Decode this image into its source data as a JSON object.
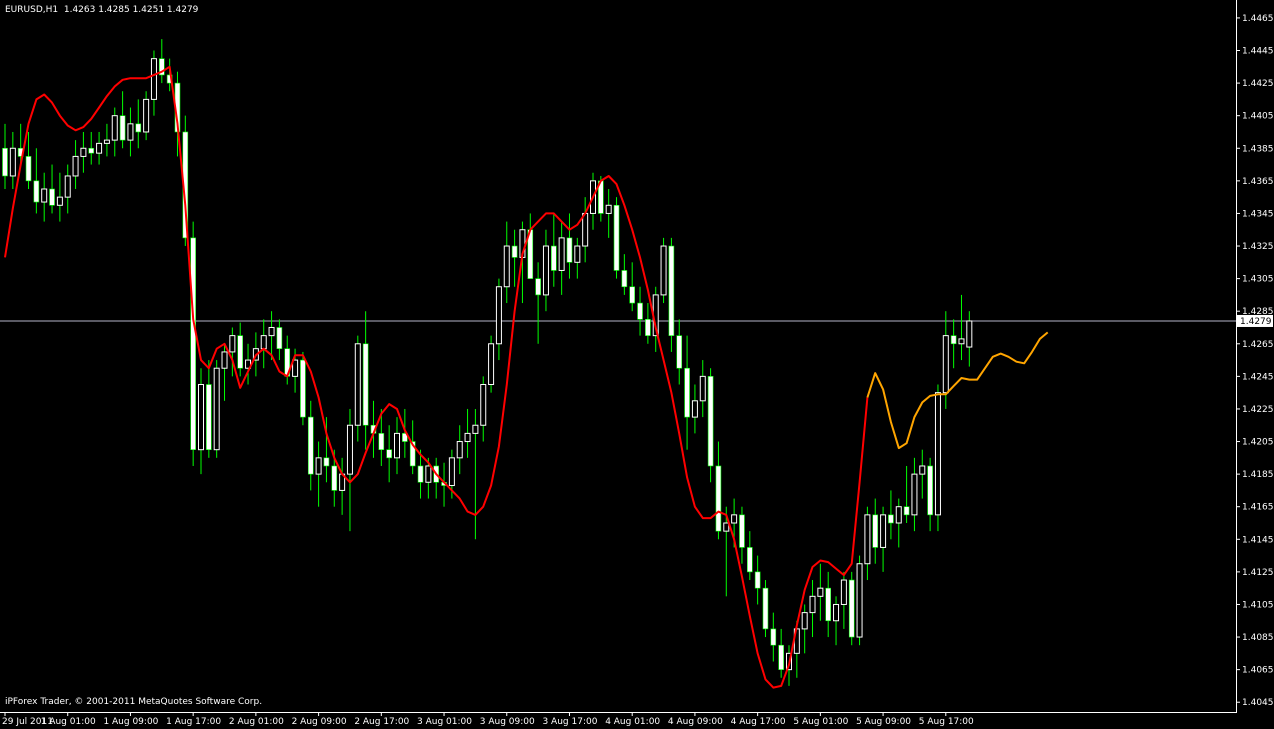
{
  "header": {
    "symbol_tf": "EURUSD,H1",
    "ohlc": "1.4263 1.4285 1.4251 1.4279"
  },
  "footer": {
    "copyright": "iPForex Trader, © 2001-2011 MetaQuotes Software Corp."
  },
  "colors": {
    "background": "#000000",
    "bull_candle": "#FFFFFF",
    "bear_candle": "#FFFFFF",
    "wick": "#00FF00",
    "ma_line": "#FF0000",
    "forecast_line": "#FFA500",
    "price_line": "#B4B4C8",
    "axis": "#FFFFFF"
  },
  "chart_data": {
    "type": "candlestick",
    "grid": false,
    "current_price": "1.4279",
    "y_ticks": [
      "1.4465",
      "1.4445",
      "1.4425",
      "1.4405",
      "1.4385",
      "1.4365",
      "1.4345",
      "1.4325",
      "1.4305",
      "1.4285",
      "1.4265",
      "1.4245",
      "1.4225",
      "1.4205",
      "1.4185",
      "1.4165",
      "1.4145",
      "1.4125",
      "1.4105",
      "1.4085",
      "1.4065",
      "1.4045"
    ],
    "y_tick_values": [
      1.4465,
      1.4445,
      1.4425,
      1.4405,
      1.4385,
      1.4365,
      1.4345,
      1.4325,
      1.4305,
      1.4285,
      1.4265,
      1.4245,
      1.4225,
      1.4205,
      1.4185,
      1.4165,
      1.4145,
      1.4125,
      1.4105,
      1.4085,
      1.4065,
      1.4045
    ],
    "ylim": [
      1.4039,
      1.4476
    ],
    "x_labels": [
      {
        "text": "29 Jul 2011",
        "index": 0
      },
      {
        "text": "1 Aug 01:00",
        "index": 8
      },
      {
        "text": "1 Aug 09:00",
        "index": 16
      },
      {
        "text": "1 Aug 17:00",
        "index": 24
      },
      {
        "text": "2 Aug 01:00",
        "index": 32
      },
      {
        "text": "2 Aug 09:00",
        "index": 40
      },
      {
        "text": "2 Aug 17:00",
        "index": 48
      },
      {
        "text": "3 Aug 01:00",
        "index": 56
      },
      {
        "text": "3 Aug 09:00",
        "index": 64
      },
      {
        "text": "3 Aug 17:00",
        "index": 72
      },
      {
        "text": "4 Aug 01:00",
        "index": 80
      },
      {
        "text": "4 Aug 09:00",
        "index": 88
      },
      {
        "text": "4 Aug 17:00",
        "index": 96
      },
      {
        "text": "5 Aug 01:00",
        "index": 104
      },
      {
        "text": "5 Aug 09:00",
        "index": 112
      },
      {
        "text": "5 Aug 17:00",
        "index": 120
      }
    ],
    "candles": [
      [
        1.4385,
        1.44,
        1.436,
        1.4368
      ],
      [
        1.4368,
        1.4395,
        1.436,
        1.4385
      ],
      [
        1.4385,
        1.44,
        1.4375,
        1.438
      ],
      [
        1.438,
        1.4395,
        1.436,
        1.4365
      ],
      [
        1.4365,
        1.4385,
        1.4345,
        1.4352
      ],
      [
        1.4352,
        1.437,
        1.434,
        1.436
      ],
      [
        1.436,
        1.4375,
        1.4345,
        1.435
      ],
      [
        1.435,
        1.437,
        1.434,
        1.4355
      ],
      [
        1.4355,
        1.4375,
        1.4345,
        1.4368
      ],
      [
        1.4368,
        1.439,
        1.436,
        1.438
      ],
      [
        1.438,
        1.4395,
        1.437,
        1.4385
      ],
      [
        1.4385,
        1.4395,
        1.4375,
        1.4382
      ],
      [
        1.4382,
        1.4395,
        1.4375,
        1.4388
      ],
      [
        1.4388,
        1.44,
        1.438,
        1.439
      ],
      [
        1.439,
        1.441,
        1.438,
        1.4405
      ],
      [
        1.4405,
        1.442,
        1.4385,
        1.439
      ],
      [
        1.439,
        1.441,
        1.438,
        1.44
      ],
      [
        1.44,
        1.4415,
        1.4385,
        1.4395
      ],
      [
        1.4395,
        1.442,
        1.439,
        1.4415
      ],
      [
        1.4415,
        1.4445,
        1.4405,
        1.444
      ],
      [
        1.444,
        1.4452,
        1.4425,
        1.443
      ],
      [
        1.443,
        1.444,
        1.442,
        1.4425
      ],
      [
        1.4425,
        1.4432,
        1.438,
        1.4395
      ],
      [
        1.4395,
        1.4405,
        1.4325,
        1.433
      ],
      [
        1.433,
        1.434,
        1.419,
        1.42
      ],
      [
        1.42,
        1.425,
        1.4185,
        1.424
      ],
      [
        1.424,
        1.4255,
        1.4195,
        1.42
      ],
      [
        1.42,
        1.4255,
        1.4195,
        1.425
      ],
      [
        1.425,
        1.4265,
        1.423,
        1.426
      ],
      [
        1.426,
        1.4275,
        1.4245,
        1.427
      ],
      [
        1.427,
        1.4278,
        1.4245,
        1.425
      ],
      [
        1.425,
        1.4265,
        1.424,
        1.4255
      ],
      [
        1.4255,
        1.4272,
        1.4245,
        1.4262
      ],
      [
        1.4262,
        1.428,
        1.425,
        1.427
      ],
      [
        1.427,
        1.4285,
        1.4255,
        1.4275
      ],
      [
        1.4275,
        1.428,
        1.4255,
        1.4262
      ],
      [
        1.4262,
        1.427,
        1.424,
        1.4245
      ],
      [
        1.4245,
        1.4262,
        1.4235,
        1.4255
      ],
      [
        1.4255,
        1.426,
        1.4215,
        1.422
      ],
      [
        1.422,
        1.423,
        1.4175,
        1.4185
      ],
      [
        1.4185,
        1.4205,
        1.4165,
        1.4195
      ],
      [
        1.4195,
        1.422,
        1.418,
        1.419
      ],
      [
        1.419,
        1.42,
        1.4165,
        1.4175
      ],
      [
        1.4175,
        1.4195,
        1.416,
        1.4185
      ],
      [
        1.4185,
        1.4225,
        1.415,
        1.4215
      ],
      [
        1.4215,
        1.427,
        1.4205,
        1.4265
      ],
      [
        1.4265,
        1.4285,
        1.42,
        1.4215
      ],
      [
        1.4215,
        1.423,
        1.4195,
        1.421
      ],
      [
        1.421,
        1.4225,
        1.419,
        1.42
      ],
      [
        1.42,
        1.4215,
        1.418,
        1.4195
      ],
      [
        1.4195,
        1.422,
        1.4185,
        1.421
      ],
      [
        1.421,
        1.4225,
        1.4195,
        1.4205
      ],
      [
        1.4205,
        1.4218,
        1.4185,
        1.419
      ],
      [
        1.419,
        1.42,
        1.417,
        1.418
      ],
      [
        1.418,
        1.4195,
        1.417,
        1.419
      ],
      [
        1.419,
        1.4195,
        1.417,
        1.418
      ],
      [
        1.418,
        1.4192,
        1.4165,
        1.4178
      ],
      [
        1.4178,
        1.42,
        1.417,
        1.4195
      ],
      [
        1.4195,
        1.4215,
        1.4185,
        1.4205
      ],
      [
        1.4205,
        1.4225,
        1.4195,
        1.421
      ],
      [
        1.421,
        1.4225,
        1.4145,
        1.4215
      ],
      [
        1.4215,
        1.4245,
        1.4205,
        1.424
      ],
      [
        1.424,
        1.427,
        1.4235,
        1.4265
      ],
      [
        1.4265,
        1.4305,
        1.4255,
        1.43
      ],
      [
        1.43,
        1.434,
        1.429,
        1.4325
      ],
      [
        1.4325,
        1.4335,
        1.43,
        1.4318
      ],
      [
        1.4318,
        1.434,
        1.429,
        1.4335
      ],
      [
        1.4335,
        1.4345,
        1.431,
        1.4305
      ],
      [
        1.4305,
        1.4315,
        1.4265,
        1.4295
      ],
      [
        1.4295,
        1.4335,
        1.4285,
        1.4325
      ],
      [
        1.4325,
        1.4345,
        1.43,
        1.431
      ],
      [
        1.431,
        1.434,
        1.4295,
        1.433
      ],
      [
        1.433,
        1.4345,
        1.4305,
        1.4315
      ],
      [
        1.4315,
        1.433,
        1.4305,
        1.4325
      ],
      [
        1.4325,
        1.4355,
        1.4315,
        1.4345
      ],
      [
        1.4345,
        1.437,
        1.4335,
        1.4365
      ],
      [
        1.4365,
        1.4368,
        1.434,
        1.4345
      ],
      [
        1.4345,
        1.436,
        1.433,
        1.435
      ],
      [
        1.435,
        1.4355,
        1.4305,
        1.431
      ],
      [
        1.431,
        1.432,
        1.4295,
        1.43
      ],
      [
        1.43,
        1.4315,
        1.4285,
        1.429
      ],
      [
        1.429,
        1.43,
        1.427,
        1.428
      ],
      [
        1.428,
        1.429,
        1.4265,
        1.427
      ],
      [
        1.427,
        1.43,
        1.426,
        1.4295
      ],
      [
        1.4295,
        1.433,
        1.429,
        1.4325
      ],
      [
        1.4325,
        1.433,
        1.426,
        1.427
      ],
      [
        1.427,
        1.428,
        1.424,
        1.425
      ],
      [
        1.425,
        1.427,
        1.42,
        1.422
      ],
      [
        1.422,
        1.424,
        1.421,
        1.423
      ],
      [
        1.423,
        1.4255,
        1.422,
        1.4245
      ],
      [
        1.4245,
        1.425,
        1.418,
        1.419
      ],
      [
        1.419,
        1.4205,
        1.4145,
        1.415
      ],
      [
        1.415,
        1.4165,
        1.411,
        1.4155
      ],
      [
        1.4155,
        1.417,
        1.414,
        1.416
      ],
      [
        1.416,
        1.4165,
        1.413,
        1.414
      ],
      [
        1.414,
        1.415,
        1.412,
        1.4125
      ],
      [
        1.4125,
        1.4135,
        1.4105,
        1.4115
      ],
      [
        1.4115,
        1.412,
        1.4085,
        1.409
      ],
      [
        1.409,
        1.41,
        1.407,
        1.408
      ],
      [
        1.408,
        1.409,
        1.406,
        1.4065
      ],
      [
        1.4065,
        1.408,
        1.4055,
        1.4075
      ],
      [
        1.4075,
        1.4095,
        1.406,
        1.409
      ],
      [
        1.409,
        1.4105,
        1.4075,
        1.41
      ],
      [
        1.41,
        1.412,
        1.4085,
        1.411
      ],
      [
        1.411,
        1.413,
        1.4095,
        1.4115
      ],
      [
        1.4115,
        1.4125,
        1.4085,
        1.4095
      ],
      [
        1.4095,
        1.411,
        1.408,
        1.4105
      ],
      [
        1.4105,
        1.4125,
        1.409,
        1.412
      ],
      [
        1.412,
        1.4125,
        1.408,
        1.4085
      ],
      [
        1.4085,
        1.4135,
        1.408,
        1.413
      ],
      [
        1.413,
        1.4165,
        1.412,
        1.416
      ],
      [
        1.416,
        1.417,
        1.413,
        1.414
      ],
      [
        1.414,
        1.4165,
        1.4125,
        1.416
      ],
      [
        1.416,
        1.4175,
        1.4145,
        1.4155
      ],
      [
        1.4155,
        1.417,
        1.414,
        1.4165
      ],
      [
        1.4165,
        1.419,
        1.4155,
        1.416
      ],
      [
        1.416,
        1.4195,
        1.415,
        1.4185
      ],
      [
        1.4185,
        1.42,
        1.417,
        1.419
      ],
      [
        1.419,
        1.4195,
        1.415,
        1.416
      ],
      [
        1.416,
        1.424,
        1.415,
        1.4235
      ],
      [
        1.4235,
        1.4285,
        1.4225,
        1.427
      ],
      [
        1.427,
        1.428,
        1.425,
        1.4265
      ],
      [
        1.4265,
        1.4295,
        1.4255,
        1.4268
      ],
      [
        1.4263,
        1.4285,
        1.4251,
        1.4279
      ]
    ],
    "ma_series": [
      [
        0,
        1.4318
      ],
      [
        1,
        1.4348
      ],
      [
        2,
        1.4375
      ],
      [
        3,
        1.44
      ],
      [
        4,
        1.4415
      ],
      [
        5,
        1.4418
      ],
      [
        6,
        1.4413
      ],
      [
        7,
        1.4405
      ],
      [
        8,
        1.4399
      ],
      [
        9,
        1.4396
      ],
      [
        10,
        1.4398
      ],
      [
        11,
        1.4403
      ],
      [
        12,
        1.441
      ],
      [
        13,
        1.4417
      ],
      [
        14,
        1.4423
      ],
      [
        15,
        1.4427
      ],
      [
        16,
        1.4428
      ],
      [
        17,
        1.4428
      ],
      [
        18,
        1.4428
      ],
      [
        19,
        1.443
      ],
      [
        20,
        1.4432
      ],
      [
        21,
        1.4435
      ],
      [
        22,
        1.44
      ],
      [
        23,
        1.435
      ],
      [
        24,
        1.428
      ],
      [
        25,
        1.4255
      ],
      [
        26,
        1.425
      ],
      [
        27,
        1.4262
      ],
      [
        28,
        1.4265
      ],
      [
        29,
        1.4255
      ],
      [
        30,
        1.4238
      ],
      [
        31,
        1.4248
      ],
      [
        32,
        1.4258
      ],
      [
        33,
        1.4262
      ],
      [
        34,
        1.4258
      ],
      [
        35,
        1.4248
      ],
      [
        36,
        1.4245
      ],
      [
        37,
        1.4258
      ],
      [
        38,
        1.4258
      ],
      [
        39,
        1.4248
      ],
      [
        40,
        1.4232
      ],
      [
        41,
        1.421
      ],
      [
        42,
        1.4195
      ],
      [
        43,
        1.4185
      ],
      [
        44,
        1.418
      ],
      [
        45,
        1.4185
      ],
      [
        46,
        1.4198
      ],
      [
        47,
        1.421
      ],
      [
        48,
        1.4222
      ],
      [
        49,
        1.4228
      ],
      [
        50,
        1.4225
      ],
      [
        51,
        1.4212
      ],
      [
        52,
        1.4203
      ],
      [
        53,
        1.4197
      ],
      [
        54,
        1.4192
      ],
      [
        55,
        1.4185
      ],
      [
        56,
        1.418
      ],
      [
        57,
        1.4175
      ],
      [
        58,
        1.417
      ],
      [
        59,
        1.4162
      ],
      [
        60,
        1.416
      ],
      [
        61,
        1.4165
      ],
      [
        62,
        1.4178
      ],
      [
        63,
        1.4202
      ],
      [
        64,
        1.424
      ],
      [
        65,
        1.4285
      ],
      [
        66,
        1.432
      ],
      [
        67,
        1.4335
      ],
      [
        68,
        1.434
      ],
      [
        69,
        1.4345
      ],
      [
        70,
        1.4345
      ],
      [
        71,
        1.434
      ],
      [
        72,
        1.4335
      ],
      [
        73,
        1.4338
      ],
      [
        74,
        1.4345
      ],
      [
        75,
        1.4355
      ],
      [
        76,
        1.4365
      ],
      [
        77,
        1.4368
      ],
      [
        78,
        1.4363
      ],
      [
        79,
        1.435
      ],
      [
        80,
        1.4335
      ],
      [
        81,
        1.4318
      ],
      [
        82,
        1.4298
      ],
      [
        83,
        1.4275
      ],
      [
        84,
        1.4255
      ],
      [
        85,
        1.4235
      ],
      [
        86,
        1.421
      ],
      [
        87,
        1.4183
      ],
      [
        88,
        1.4165
      ],
      [
        89,
        1.4158
      ],
      [
        90,
        1.4158
      ],
      [
        91,
        1.4162
      ],
      [
        92,
        1.416
      ],
      [
        93,
        1.4145
      ],
      [
        94,
        1.4122
      ],
      [
        95,
        1.4098
      ],
      [
        96,
        1.4075
      ],
      [
        97,
        1.4059
      ],
      [
        98,
        1.4054
      ],
      [
        99,
        1.4055
      ],
      [
        100,
        1.4068
      ],
      [
        101,
        1.4092
      ],
      [
        102,
        1.4114
      ],
      [
        103,
        1.4128
      ],
      [
        104,
        1.4132
      ],
      [
        105,
        1.4131
      ],
      [
        106,
        1.4127
      ],
      [
        107,
        1.4123
      ],
      [
        108,
        1.413
      ],
      [
        109,
        1.418
      ],
      [
        110,
        1.4232
      ]
    ],
    "forecast_series": [
      [
        110,
        1.4232
      ],
      [
        111,
        1.4247
      ],
      [
        112,
        1.4237
      ],
      [
        113,
        1.4217
      ],
      [
        114,
        1.4201
      ],
      [
        115,
        1.4204
      ],
      [
        116,
        1.422
      ],
      [
        117,
        1.4229
      ],
      [
        118,
        1.4233
      ],
      [
        119,
        1.4234
      ],
      [
        120,
        1.4234
      ],
      [
        121,
        1.4239
      ],
      [
        122,
        1.4244
      ],
      [
        123,
        1.4243
      ],
      [
        124,
        1.4243
      ],
      [
        125,
        1.425
      ],
      [
        126,
        1.4257
      ],
      [
        127,
        1.4259
      ],
      [
        128,
        1.4257
      ],
      [
        129,
        1.4254
      ],
      [
        130,
        1.4253
      ],
      [
        131,
        1.426
      ],
      [
        132,
        1.4268
      ],
      [
        133,
        1.4272
      ]
    ]
  }
}
